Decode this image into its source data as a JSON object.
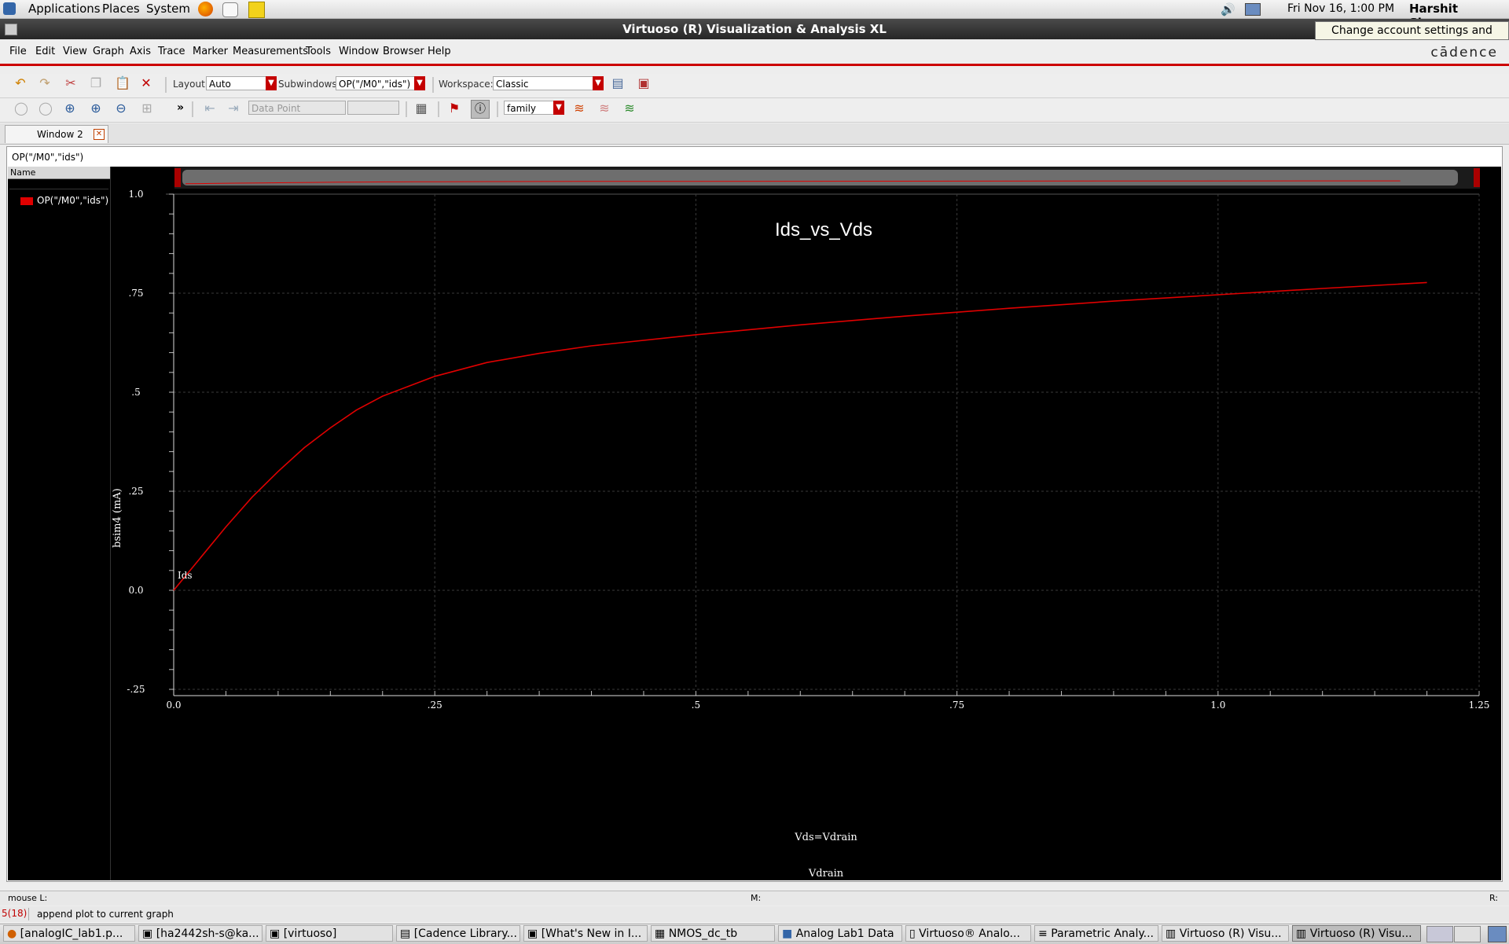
{
  "top_panel": {
    "applications": "Applications",
    "places": "Places",
    "system": "System",
    "datetime": "Fri Nov 16,  1:00 PM",
    "user": "Harshit Sharma",
    "tooltip": "Change account settings and status"
  },
  "window_title": "Virtuoso (R) Visualization & Analysis XL",
  "brand": "cādence",
  "menu": [
    "File",
    "Edit",
    "View",
    "Graph",
    "Axis",
    "Trace",
    "Marker",
    "Measurements",
    "Tools",
    "Window",
    "Browser",
    "Help"
  ],
  "toolbar1": {
    "layout_label": "Layout:",
    "layout_value": "Auto",
    "subwindows_label": "Subwindows:",
    "subwindows_value": "OP(\"/M0\",\"ids\")",
    "workspace_label": "Workspace:",
    "workspace_value": "Classic"
  },
  "toolbar2": {
    "marker_mode": "Data Point",
    "family_value": "family",
    "more": "»"
  },
  "tab": {
    "label": "Window 2"
  },
  "subwindow_title": "OP(\"/M0\",\"ids\")",
  "sidebar": {
    "header": "Name",
    "trace_name": "OP(\"/M0\",\"ids\")"
  },
  "colors": {
    "trace": "#e00000",
    "plot_bg": "#000000",
    "grid": "#3a3a3a",
    "accent": "#cc0000"
  },
  "chart_data": {
    "type": "line",
    "title": "Ids_vs_Vds",
    "xlabel": "Vdrain",
    "ylabel": "bsim4 (mA)",
    "x_annotation": "Vds=Vdrain",
    "trace_label": "Ids",
    "xlim": [
      0,
      1.25
    ],
    "ylim": [
      -0.25,
      1.0
    ],
    "xticks": [
      "0.0",
      ".25",
      ".5",
      ".75",
      "1.0",
      "1.25"
    ],
    "yticks": [
      "-.25",
      "0.0",
      ".25",
      ".5",
      ".75",
      "1.0"
    ],
    "grid": true,
    "series": [
      {
        "x": [
          0.0,
          0.025,
          0.05,
          0.075,
          0.1,
          0.125,
          0.15,
          0.175,
          0.2,
          0.225,
          0.25,
          0.3,
          0.35,
          0.4,
          0.5,
          0.6,
          0.7,
          0.8,
          0.9,
          1.0,
          1.1,
          1.2
        ],
        "values": [
          0.0,
          0.08,
          0.16,
          0.235,
          0.3,
          0.36,
          0.41,
          0.455,
          0.49,
          0.515,
          0.54,
          0.575,
          0.598,
          0.617,
          0.645,
          0.67,
          0.692,
          0.712,
          0.73,
          0.746,
          0.762,
          0.777
        ]
      }
    ]
  },
  "status": {
    "mouse_left": "mouse L:",
    "mouse_mid": "M:",
    "mouse_right": "R:",
    "cmd_index": "5(18)",
    "cmd_text": "append plot to current graph"
  },
  "taskbar": [
    {
      "label": "[analogIC_lab1.p...",
      "active": false
    },
    {
      "label": "[ha2442sh-s@ka...",
      "active": false
    },
    {
      "label": "[virtuoso]",
      "active": false
    },
    {
      "label": "[Cadence Library...",
      "active": false
    },
    {
      "label": "[What's New in I...",
      "active": false
    },
    {
      "label": "NMOS_dc_tb",
      "active": false
    },
    {
      "label": "Analog Lab1 Data",
      "active": false
    },
    {
      "label": "Virtuoso® Analo...",
      "active": false
    },
    {
      "label": "Parametric Analy...",
      "active": false
    },
    {
      "label": "Virtuoso (R) Visu...",
      "active": false
    },
    {
      "label": "Virtuoso (R) Visu...",
      "active": true
    }
  ]
}
